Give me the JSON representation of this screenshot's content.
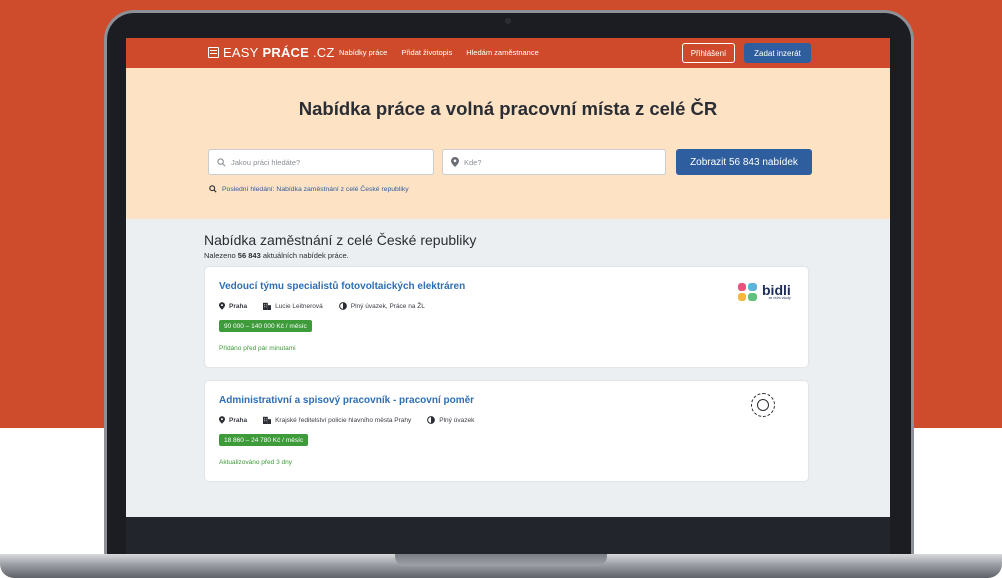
{
  "nav": {
    "logo_light": "EASY",
    "logo_bold": "PRÁCE",
    "logo_suffix": ".CZ",
    "links": [
      "Nabídky práce",
      "Přidat životopis",
      "Hledám zaměstnance"
    ],
    "login": "Přihlášení",
    "post_ad": "Zadat inzerát"
  },
  "hero": {
    "title": "Nabídka práce a volná pracovní místa z celé ČR",
    "search_placeholder": "Jakou práci hledáte?",
    "location_placeholder": "Kde?",
    "search_button": "Zobrazit 56 843 nabídek",
    "recent_search": "Poslední hledání: Nabídka zaměstnání z celé České republiky"
  },
  "results": {
    "title": "Nabídka zaměstnání z celé České republiky",
    "found_prefix": "Nalezeno",
    "found_count": "56 843",
    "found_suffix": "aktuálních nabídek práce."
  },
  "jobs": [
    {
      "title": "Vedoucí týmu specialistů fotovoltaických elektráren",
      "location": "Praha",
      "company": "Lucie Leitnerová",
      "type": "Plný úvazek, Práce na ŽL",
      "salary": "90 000 – 140 000 Kč / měsíc",
      "added": "Přidáno před pár minutami",
      "logo_word": "bidli",
      "logo_sub": "se vším všudy"
    },
    {
      "title": "Administrativní a spisový pracovník - pracovní poměr",
      "location": "Praha",
      "company": "Krajské ředitelství policie hlavního města Prahy",
      "type": "Plný úvazek",
      "salary": "18 860 – 24 780 Kč / měsíc",
      "added": "Aktualizováno před 3 dny"
    }
  ],
  "colors": {
    "brand": "#cf4a2a",
    "accent": "#2e5e9e",
    "salary": "#3d9b3a",
    "hero_bg": "#fde2c4"
  }
}
